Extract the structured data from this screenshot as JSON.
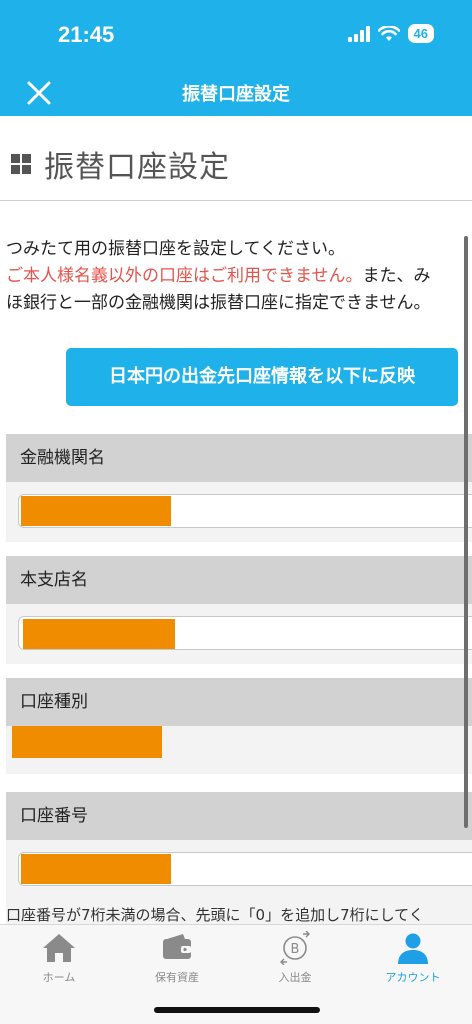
{
  "status_bar": {
    "time": "21:45",
    "battery": "46"
  },
  "header": {
    "title": "振替口座設定",
    "close_icon": "close-icon"
  },
  "page": {
    "heading": "振替口座設定",
    "description": {
      "line1": "つみたて用の振替口座を設定してください。",
      "line2_warning": "ご本人様名義以外の口座はご利用できません。",
      "line2_rest": "また、み",
      "line3": "ほ銀行と一部の金融機関は振替口座に指定できません。"
    },
    "reflect_button": "日本円の出金先口座情報を以下に反映",
    "fields": {
      "bank_name": {
        "label": "金融機関名"
      },
      "branch_name": {
        "label": "本支店名"
      },
      "account_type": {
        "label": "口座種別"
      },
      "account_number": {
        "label": "口座番号"
      }
    },
    "account_number_note": "口座番号が7桁未満の場合、先頭に「0」を追加し7桁にしてく"
  },
  "tabbar": {
    "tabs": [
      {
        "label": "ホーム",
        "icon": "home-icon",
        "active": false
      },
      {
        "label": "保有資産",
        "icon": "wallet-icon",
        "active": false
      },
      {
        "label": "入出金",
        "icon": "bitcoin-transfer-icon",
        "active": false
      },
      {
        "label": "アカウント",
        "icon": "person-icon",
        "active": true
      }
    ]
  },
  "colors": {
    "accent": "#1eb1ea",
    "warning": "#e5534b",
    "redaction": "#f08c00",
    "active_tab": "#1e9fe6"
  }
}
